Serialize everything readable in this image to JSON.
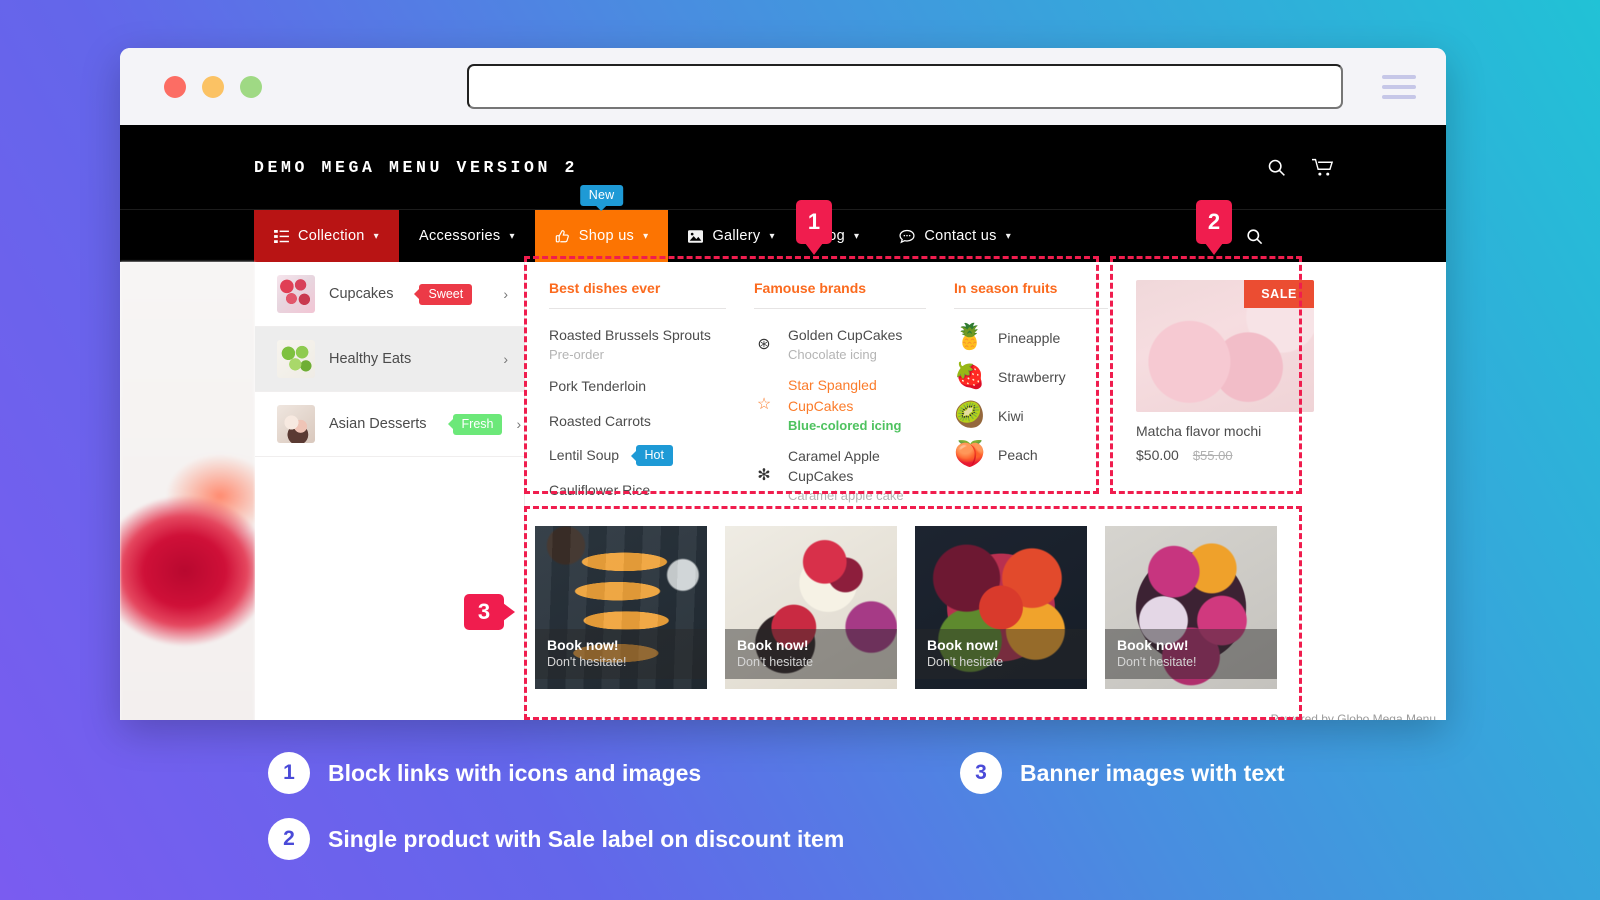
{
  "browser": {
    "url_value": "",
    "url_placeholder": ""
  },
  "site": {
    "brand": "DEMO MEGA MENU VERSION 2"
  },
  "nav": [
    {
      "label": "Collection",
      "icon": "list-icon",
      "style": "red",
      "caret": "⌄",
      "badge": ""
    },
    {
      "label": "Accessories",
      "icon": "",
      "style": "plain",
      "caret": "⌄",
      "badge": ""
    },
    {
      "label": "Shop us",
      "icon": "thumbs-up-icon",
      "style": "orange",
      "caret": "⌄",
      "badge": "New"
    },
    {
      "label": "Gallery",
      "icon": "image-icon",
      "style": "plain",
      "caret": "⌄",
      "badge": ""
    },
    {
      "label": "Blog",
      "icon": "",
      "style": "plain",
      "caret": "⌄",
      "badge": ""
    },
    {
      "label": "Contact us",
      "icon": "chat-icon",
      "style": "plain",
      "caret": "⌄",
      "badge": ""
    }
  ],
  "sidebar": [
    {
      "label": "Cupcakes",
      "tag": "Sweet",
      "tag_color": "#ec3a47",
      "active": false
    },
    {
      "label": "Healthy Eats",
      "tag": "",
      "tag_color": "",
      "active": true
    },
    {
      "label": "Asian Desserts",
      "tag": "Fresh",
      "tag_color": "#6ce879",
      "active": false
    }
  ],
  "columns": {
    "dishes": {
      "title": "Best dishes ever",
      "items": [
        {
          "label": "Roasted Brussels Sprouts",
          "sub": "Pre-order",
          "tag": ""
        },
        {
          "label": "Pork Tenderloin",
          "sub": "",
          "tag": ""
        },
        {
          "label": "Roasted Carrots",
          "sub": "",
          "tag": ""
        },
        {
          "label": "Lentil Soup",
          "sub": "",
          "tag": "Hot"
        },
        {
          "label": "Cauliflower Rice",
          "sub": "",
          "tag": ""
        }
      ]
    },
    "brands": {
      "title": "Famouse brands",
      "items": [
        {
          "icon": "circled-asterisk-icon",
          "glyph": "⊛",
          "label": "Golden CupCakes",
          "sub": "Chocolate icing",
          "highlight": false
        },
        {
          "icon": "star-outline-icon",
          "glyph": "☆",
          "label": "Star Spangled CupCakes",
          "sub": "Blue-colored icing",
          "highlight": true
        },
        {
          "icon": "asterisk-icon",
          "glyph": "✻",
          "label": "Caramel Apple CupCakes",
          "sub": "Caramel apple cake",
          "highlight": false
        }
      ]
    },
    "fruits": {
      "title": "In season fruits",
      "items": [
        {
          "emoji": "🍍",
          "label": "Pineapple",
          "icon": "pineapple-icon"
        },
        {
          "emoji": "🍓",
          "label": "Strawberry",
          "icon": "strawberry-icon"
        },
        {
          "emoji": "🥝",
          "label": "Kiwi",
          "icon": "kiwi-icon"
        },
        {
          "emoji": "🍑",
          "label": "Peach",
          "icon": "peach-icon"
        }
      ]
    }
  },
  "product": {
    "sale_label": "SALE",
    "name": "Matcha flavor mochi",
    "price": "$50.00",
    "price_compare": "$55.00"
  },
  "banners": [
    {
      "title": "Book now!",
      "sub": "Don't hesitate!"
    },
    {
      "title": "Book now!",
      "sub": "Don't hesitate"
    },
    {
      "title": "Book now!",
      "sub": "Don't hesitate"
    },
    {
      "title": "Book now!",
      "sub": "Don't hesitate!"
    }
  ],
  "footer": {
    "powered": "Powered by Globo Mega Menu"
  },
  "markers": {
    "one": "1",
    "two": "2",
    "three": "3"
  },
  "legend": [
    {
      "num": "1",
      "text": "Block links with icons and images"
    },
    {
      "num": "2",
      "text": "Single product with Sale label on discount item"
    },
    {
      "num": "3",
      "text": "Banner images with text"
    }
  ],
  "colors": {
    "accent_red": "#f01d4e",
    "nav_red": "#b81414",
    "nav_orange": "#fc7402",
    "title_orange": "#fb6a1e",
    "badge_blue": "#1e9ad6",
    "tag_green": "#6ce879",
    "sale_red": "#eb4d32"
  }
}
